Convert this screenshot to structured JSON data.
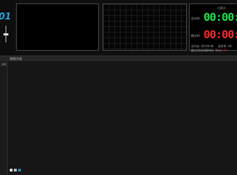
{
  "logo": {
    "text": "01"
  },
  "timer": {
    "header": "比赛计",
    "label_total": "总计时:",
    "label_remaining": "倒计时:",
    "digits_total": "00:00:0",
    "digits_remaining": "00:00:0",
    "info_line1_left": "总时长: 00:00:00",
    "info_line1_right": "采样率: 60",
    "info_line2_left": "最后时间间隔时间: 00s/",
    "info_line2_right": "1.00",
    "colors": {
      "green": "#19e04a",
      "red": "#f02a2a"
    }
  },
  "list_panel": {
    "title": "视频/文档",
    "collapse_label": "<<"
  },
  "bottom_toolbar": {
    "icons": [
      "new-icon",
      "save-icon",
      "settings-icon"
    ]
  },
  "colors": {
    "accent": "#1fa8e8",
    "background": "#141414"
  }
}
